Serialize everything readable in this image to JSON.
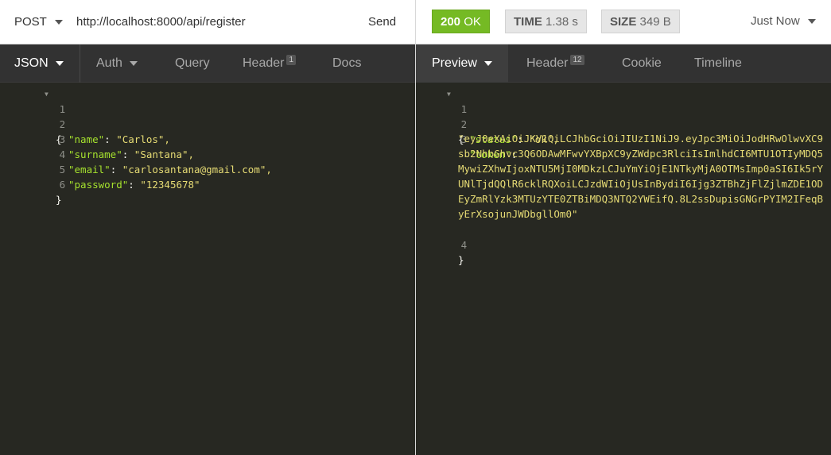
{
  "request": {
    "method": "POST",
    "url": "http://localhost:8000/api/register",
    "send_label": "Send"
  },
  "response": {
    "status_code": "200",
    "status_text": "OK",
    "time_label": "TIME",
    "time_value": "1.38 s",
    "size_label": "SIZE",
    "size_value": "349 B",
    "history_label": "Just Now"
  },
  "request_tabs": [
    {
      "label": "JSON"
    },
    {
      "label": "Auth"
    },
    {
      "label": "Query"
    },
    {
      "label": "Header",
      "count": "1"
    },
    {
      "label": "Docs"
    }
  ],
  "response_tabs": [
    {
      "label": "Preview"
    },
    {
      "label": "Header",
      "count": "12"
    },
    {
      "label": "Cookie"
    },
    {
      "label": "Timeline"
    }
  ],
  "request_body": {
    "line_numbers": [
      "1",
      "2",
      "3",
      "4",
      "5",
      "6"
    ],
    "open_brace": "{",
    "close_brace": "}",
    "fields": [
      {
        "key": "\"name\"",
        "value": "\"Carlos\","
      },
      {
        "key": "\"surname\"",
        "value": "\"Santana\","
      },
      {
        "key": "\"email\"",
        "value": "\"carlosantana@gmail.com\","
      },
      {
        "key": "\"password\"",
        "value": "\"12345678\""
      }
    ]
  },
  "response_body": {
    "line_numbers": [
      "1",
      "2",
      "3",
      "4"
    ],
    "open_brace": "{",
    "close_brace": "}",
    "status_key": "\"status\"",
    "status_value": "\"ok\",",
    "token_key": "\"token\"",
    "token_value": "\"eyJ0eXAiOiJKV1QiLCJhbGciOiJIUzI1NiJ9.eyJpc3MiOiJodHRwOlwvXC9sb2NhbGhvc3Q6ODAwMFwvYXBpXC9yZWdpc3RlciIsImlhdCI6MTU1OTIyMDQ5MywiZXhwIjoxNTU5MjI0MDkzLCJuYmYiOjE1NTkyMjA0OTMsImp0aSI6Ik5rYUNlTjdQQlR6cklRQXoiLCJzdWIiOjUsInBydiI6Ijg3ZTBhZjFlZjlmZDE1ODEyZmRlYzk3MTUzYTE0ZTBiMDQ3NTQ2YWEifQ.8L2ssDupisGNGrPYIM2IFeqByErXsojunJWDbgllOm0\""
  },
  "colors": {
    "editor_bg": "#272822",
    "tab_bg": "#323232",
    "ok_green": "#75ba24",
    "json_key": "#a6e22e",
    "json_string": "#e6db74"
  }
}
